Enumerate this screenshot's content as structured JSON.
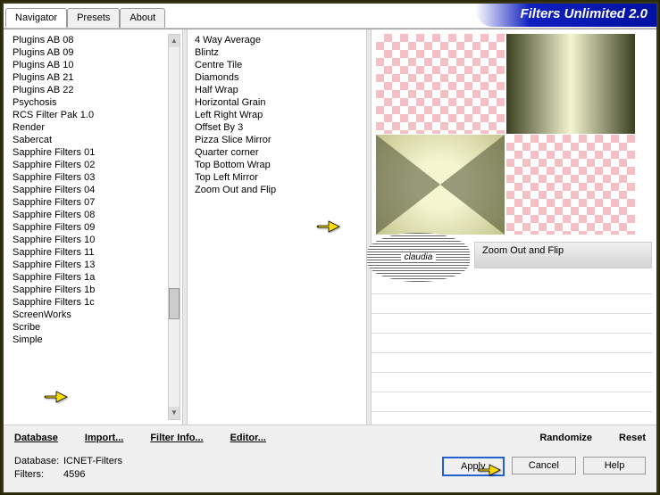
{
  "title": "Filters Unlimited 2.0",
  "tabs": [
    "Navigator",
    "Presets",
    "About"
  ],
  "plugins": [
    "Plugins AB 08",
    "Plugins AB 09",
    "Plugins AB 10",
    "Plugins AB 21",
    "Plugins AB 22",
    "Psychosis",
    "RCS Filter Pak 1.0",
    "Render",
    "Sabercat",
    "Sapphire Filters 01",
    "Sapphire Filters 02",
    "Sapphire Filters 03",
    "Sapphire Filters 04",
    "Sapphire Filters 07",
    "Sapphire Filters 08",
    "Sapphire Filters 09",
    "Sapphire Filters 10",
    "Sapphire Filters 11",
    "Sapphire Filters 13",
    "Sapphire Filters 1a",
    "Sapphire Filters 1b",
    "Sapphire Filters 1c",
    "ScreenWorks",
    "Scribe",
    "Simple"
  ],
  "filters": [
    "4 Way Average",
    "Blintz",
    "Centre Tile",
    "Diamonds",
    "Half Wrap",
    "Horizontal Grain",
    "Left Right Wrap",
    "Offset By 3",
    "Pizza Slice Mirror",
    "Quarter corner",
    "Top Bottom Wrap",
    "Top Left Mirror",
    "Zoom Out and Flip"
  ],
  "selected_filter": "Zoom Out and Flip",
  "effect_name": "Zoom Out and Flip",
  "watermark": "claudia",
  "toolbar": {
    "database": "Database",
    "import": "Import...",
    "filterinfo": "Filter Info...",
    "editor": "Editor...",
    "randomize": "Randomize",
    "reset": "Reset"
  },
  "info": {
    "db_label": "Database:",
    "db_value": "ICNET-Filters",
    "filters_label": "Filters:",
    "filters_value": "4596"
  },
  "buttons": {
    "apply": "Apply",
    "cancel": "Cancel",
    "help": "Help"
  }
}
